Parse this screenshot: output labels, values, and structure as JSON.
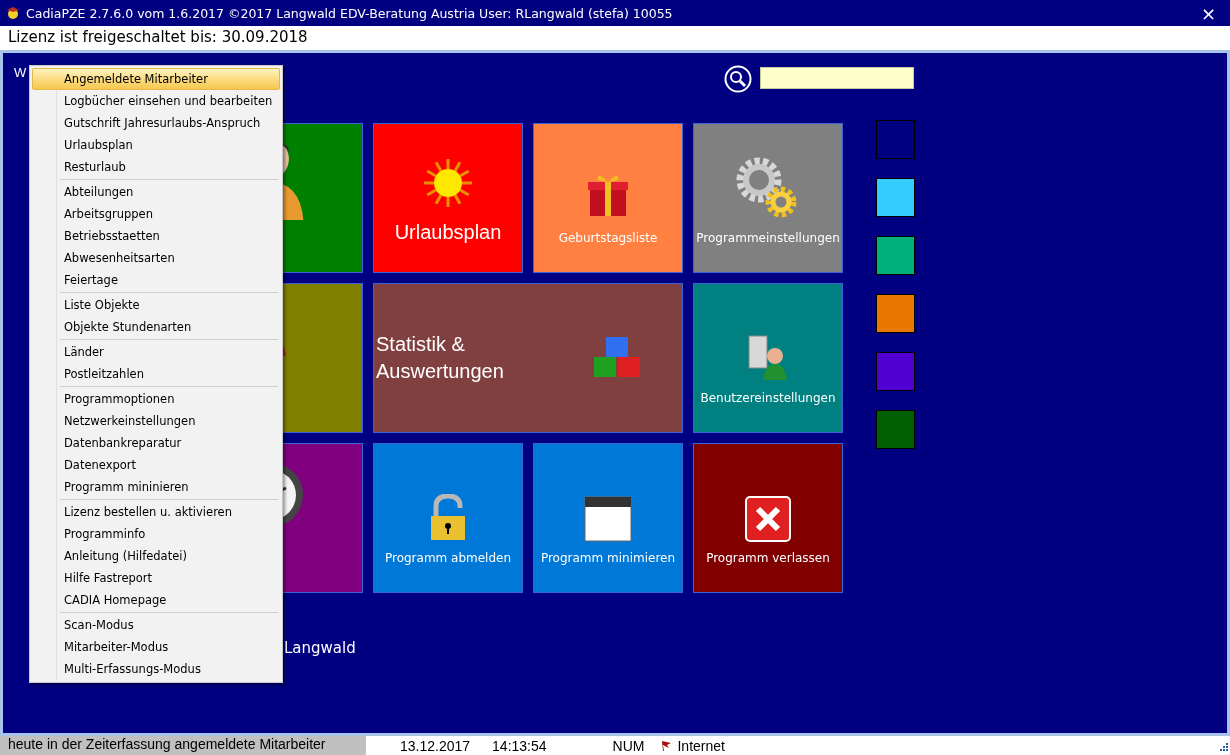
{
  "window": {
    "title": "CadiaPZE 2.7.6.0 vom 1.6.2017 ©2017 Langwald EDV-Beratung Austria User: RLangwald (stefa) 10055",
    "close": "×"
  },
  "license": "Lizenz ist freigeschaltet bis: 30.09.2018",
  "header": {
    "greeting": "W"
  },
  "tiles": [
    {
      "kind": "small",
      "color": "#008000"
    },
    {
      "kind": "large",
      "color": "#ff0000",
      "label": "Urlaubsplan"
    },
    {
      "kind": "small",
      "color": "#ff8040",
      "label": "Geburtstagsliste"
    },
    {
      "kind": "small",
      "color": "#808080",
      "label": "Programmeinstellungen"
    },
    {
      "kind": "small",
      "color": "#808000"
    },
    {
      "kind": "wide",
      "color": "#804040",
      "label": "Statistik & Auswertungen"
    },
    {
      "kind": "small",
      "color": "#008080",
      "label": "Benutzereinstellungen"
    },
    {
      "kind": "small",
      "color": "#800080"
    },
    {
      "kind": "small",
      "color": "#0078d7",
      "label": "Programm abmelden"
    },
    {
      "kind": "small",
      "color": "#0078d7",
      "label": "Programm minimieren"
    },
    {
      "kind": "small",
      "color": "#800000",
      "label": "Programm verlassen"
    }
  ],
  "color_swatches": [
    {
      "color": "#000080"
    },
    {
      "color": "#33ccff"
    },
    {
      "color": "#00b07a"
    },
    {
      "color": "#e87800"
    },
    {
      "color": "#5000d0"
    },
    {
      "color": "#006000"
    }
  ],
  "footer_name": "Langwald",
  "menu": {
    "groups": [
      [
        {
          "label": "Angemeldete Mitarbeiter",
          "selected": true
        },
        {
          "label": "Logbücher einsehen und bearbeiten",
          "selected": false
        },
        {
          "label": "Gutschrift Jahresurlaubs-Anspruch",
          "selected": false
        },
        {
          "label": "Urlaubsplan",
          "selected": false
        },
        {
          "label": "Resturlaub",
          "selected": false
        }
      ],
      [
        {
          "label": "Abteilungen",
          "selected": false
        },
        {
          "label": "Arbeitsgruppen",
          "selected": false
        },
        {
          "label": "Betriebsstaetten",
          "selected": false
        },
        {
          "label": "Abwesenheitsarten",
          "selected": false
        },
        {
          "label": "Feiertage",
          "selected": false
        }
      ],
      [
        {
          "label": "Liste Objekte",
          "selected": false
        },
        {
          "label": "Objekte Stundenarten",
          "selected": false
        }
      ],
      [
        {
          "label": "Länder",
          "selected": false
        },
        {
          "label": "Postleitzahlen",
          "selected": false
        }
      ],
      [
        {
          "label": "Programmoptionen",
          "selected": false
        },
        {
          "label": "Netzwerkeinstellungen",
          "selected": false
        },
        {
          "label": "Datenbankreparatur",
          "selected": false
        },
        {
          "label": "Datenexport",
          "selected": false
        },
        {
          "label": "Programm mininieren",
          "selected": false
        }
      ],
      [
        {
          "label": "Lizenz bestellen u. aktivieren",
          "selected": false
        },
        {
          "label": "Programminfo",
          "selected": false
        },
        {
          "label": "Anleitung (Hilfedatei)",
          "selected": false
        },
        {
          "label": "Hilfe Fastreport",
          "selected": false
        },
        {
          "label": "CADIA Homepage",
          "selected": false
        }
      ],
      [
        {
          "label": "Scan-Modus",
          "selected": false
        },
        {
          "label": "Mitarbeiter-Modus",
          "selected": false
        },
        {
          "label": "Multi-Erfassungs-Modus",
          "selected": false
        }
      ]
    ]
  },
  "status_bar": {
    "message": "heute in der Zeiterfassung angemeldete Mitarbeiter",
    "date": "13.12.2017",
    "time": "14:13:54",
    "keyboard": "NUM",
    "connection": "Internet"
  }
}
